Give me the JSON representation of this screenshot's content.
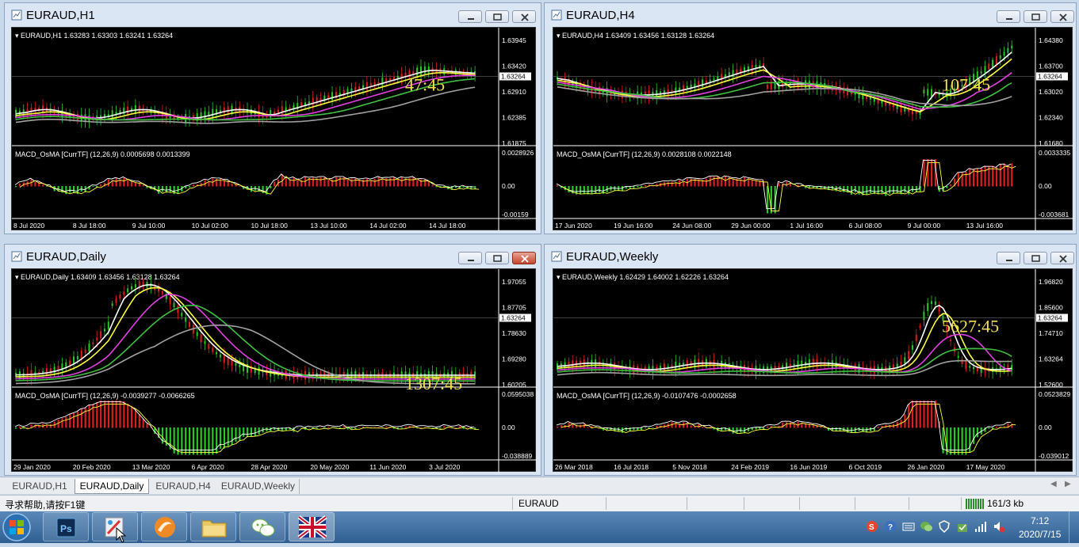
{
  "windows": [
    {
      "title": "EURAUD,H1",
      "header": "EURAUD,H1  1.63283 1.63303 1.63241 1.63264",
      "timer": "47:45",
      "price_ticks": [
        "1.63945",
        "1.63420",
        "1.62910",
        "1.62385",
        "1.61875"
      ],
      "current_price": "1.63264",
      "macd_header": "MACD_OsMA [CurrTF] (12,26,9) 0.0005698 0.0013399",
      "macd_ticks": [
        "0.0028926",
        "0.00",
        "-0.00159"
      ],
      "time_ticks": [
        "8 Jul 2020",
        "8 Jul 18:00",
        "9 Jul 10:00",
        "10 Jul 02:00",
        "10 Jul 18:00",
        "13 Jul 10:00",
        "14 Jul 02:00",
        "14 Jul 18:00"
      ]
    },
    {
      "title": "EURAUD,H4",
      "header": "EURAUD,H4  1.63409 1.63456 1.63128 1.63264",
      "timer": "107:45",
      "price_ticks": [
        "1.64380",
        "1.63700",
        "1.63020",
        "1.62340",
        "1.61680"
      ],
      "current_price": "1.63264",
      "macd_header": "MACD_OsMA [CurrTF] (12,26,9) 0.0028108 0.0022148",
      "macd_ticks": [
        "0.0033335",
        "0.00",
        "-0.003681"
      ],
      "time_ticks": [
        "17 Jun 2020",
        "19 Jun 16:00",
        "24 Jun 08:00",
        "29 Jun 00:00",
        "1 Jul 16:00",
        "6 Jul 08:00",
        "9 Jul 00:00",
        "13 Jul 16:00"
      ]
    },
    {
      "title": "EURAUD,Daily",
      "header": "EURAUD,Daily  1.63409 1.63456 1.63128 1.63264",
      "timer": "1307:45",
      "price_ticks": [
        "1.97055",
        "1.87705",
        "1.78630",
        "1.69280",
        "1.60205"
      ],
      "current_price": "1.63264",
      "macd_header": "MACD_OsMA [CurrTF] (12,26,9) -0.0039277 -0.0066265",
      "macd_ticks": [
        "0.0595038",
        "0.00",
        "-0.038889"
      ],
      "time_ticks": [
        "29 Jan 2020",
        "20 Feb 2020",
        "13 Mar 2020",
        "6 Apr 2020",
        "28 Apr 2020",
        "20 May 2020",
        "11 Jun 2020",
        "3 Jul 2020"
      ]
    },
    {
      "title": "EURAUD,Weekly",
      "header": "EURAUD,Weekly  1.62429 1.64002 1.62226 1.63264",
      "timer": "5627:45",
      "price_ticks": [
        "1.96820",
        "1.85600",
        "1.74710",
        "1.63264",
        "1.52600"
      ],
      "current_price": "1.63264",
      "macd_header": "MACD_OsMA [CurrTF] (12,26,9) -0.0107476 -0.0002658",
      "macd_ticks": [
        "0.0523829",
        "0.00",
        "-0.039012"
      ],
      "time_ticks": [
        "26 Mar 2018",
        "16 Jul 2018",
        "5 Nov 2018",
        "24 Feb 2019",
        "16 Jun 2019",
        "6 Oct 2019",
        "26 Jan 2020",
        "17 May 2020"
      ]
    }
  ],
  "tabs": [
    "EURAUD,H1",
    "EURAUD,Daily",
    "EURAUD,H4",
    "EURAUD,Weekly"
  ],
  "active_tab": "EURAUD,Daily",
  "status": {
    "help": "寻求帮助,请按F1键",
    "symbol": "EURAUD",
    "traffic": "161/3 kb"
  },
  "clock": {
    "time": "7:12",
    "date": "2020/7/15"
  },
  "colors": {
    "bull": "#28c828",
    "bear": "#dc1e1e",
    "timer": "#f0e050",
    "ma_white": "#ffffff",
    "ma_yellow": "#ffff40",
    "ma_magenta": "#e040e0",
    "ma_green": "#40c040",
    "ma_gray": "#a0a0a0"
  },
  "icons": {
    "window": "chart-window-icon",
    "minimize": "minimize-icon",
    "restore": "restore-icon",
    "close": "close-icon",
    "start": "windows-start-icon",
    "photoshop": "photoshop-icon",
    "paint": "paint-icon",
    "browser": "browser-icon",
    "explorer": "folder-icon",
    "wechat": "wechat-icon",
    "metatrader": "uk-flag-icon"
  }
}
